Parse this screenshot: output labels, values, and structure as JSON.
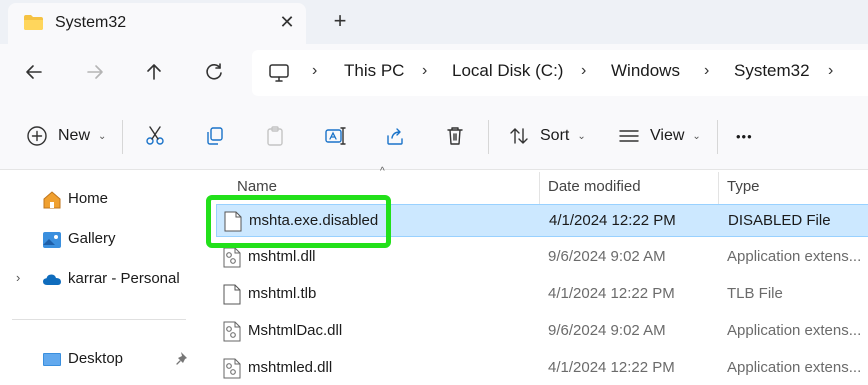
{
  "window": {
    "tab_title": "System32",
    "tab_close_glyph": "✕",
    "new_tab_glyph": "+"
  },
  "navigation": {
    "back_icon": "arrow-left-icon",
    "forward_icon": "arrow-right-icon",
    "up_icon": "arrow-up-icon",
    "refresh_icon": "refresh-icon"
  },
  "address": {
    "root_icon": "monitor-icon",
    "separator": "›",
    "crumbs": [
      "This PC",
      "Local Disk (C:)",
      "Windows",
      "System32"
    ]
  },
  "toolbar": {
    "new_label": "New",
    "sort_label": "Sort",
    "view_label": "View",
    "more_glyph": "•••",
    "caret_glyph": "⌄"
  },
  "nav_pane": {
    "items": [
      {
        "label": "Home",
        "icon": "home-icon"
      },
      {
        "label": "Gallery",
        "icon": "gallery-icon"
      },
      {
        "label": "karrar - Personal",
        "icon": "onedrive-cloud-icon"
      },
      {
        "label": "Desktop",
        "icon": "desktop-icon"
      }
    ],
    "expand_glyph": "›"
  },
  "file_list": {
    "columns": {
      "name": "Name",
      "date": "Date modified",
      "type": "Type"
    },
    "sort_glyph": "^",
    "rows": [
      {
        "name": "mshta.exe.disabled",
        "date": "4/1/2024 12:22 PM",
        "type": "DISABLED File",
        "selected": true
      },
      {
        "name": "mshtml.dll",
        "date": "9/6/2024 9:02 AM",
        "type": "Application extens..."
      },
      {
        "name": "mshtml.tlb",
        "date": "4/1/2024 12:22 PM",
        "type": "TLB File"
      },
      {
        "name": "MshtmlDac.dll",
        "date": "9/6/2024 9:02 AM",
        "type": "Application extens..."
      },
      {
        "name": "mshtmled.dll",
        "date": "4/1/2024 12:22 PM",
        "type": "Application extens..."
      }
    ]
  },
  "colors": {
    "highlight_box": "#22e01a",
    "selection_bg": "#cce8ff",
    "folder_yellow": "#f5c242",
    "accent_blue": "#0067c0"
  }
}
